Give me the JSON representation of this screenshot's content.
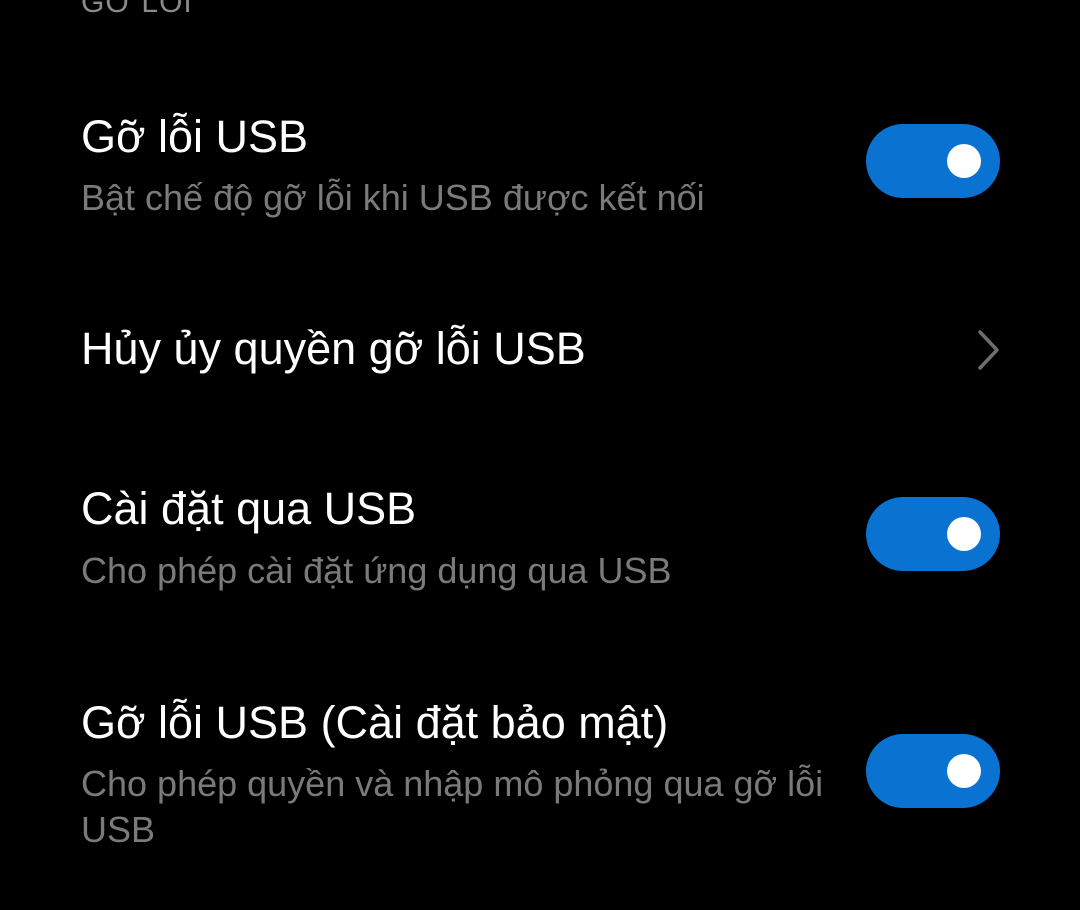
{
  "section_header": "GỠ LỖI",
  "colors": {
    "accent": "#0a72d1",
    "background": "#000000",
    "title": "#ffffff",
    "subtitle": "#7a7a7a",
    "chevron": "#6e6e6e"
  },
  "items": [
    {
      "title": "Gỡ lỗi USB",
      "subtitle": "Bật chế độ gỡ lỗi khi USB được kết nối",
      "control": "toggle",
      "checked": true
    },
    {
      "title": "Hủy ủy quyền gỡ lỗi USB",
      "control": "chevron",
      "icon": "chevron-right-icon"
    },
    {
      "title": "Cài đặt qua USB",
      "subtitle": "Cho phép cài đặt ứng dụng qua USB",
      "control": "toggle",
      "checked": true
    },
    {
      "title": "Gỡ lỗi USB (Cài đặt bảo mật)",
      "subtitle": "Cho phép quyền và nhập mô phỏng qua gỡ lỗi USB",
      "control": "toggle",
      "checked": true
    }
  ]
}
